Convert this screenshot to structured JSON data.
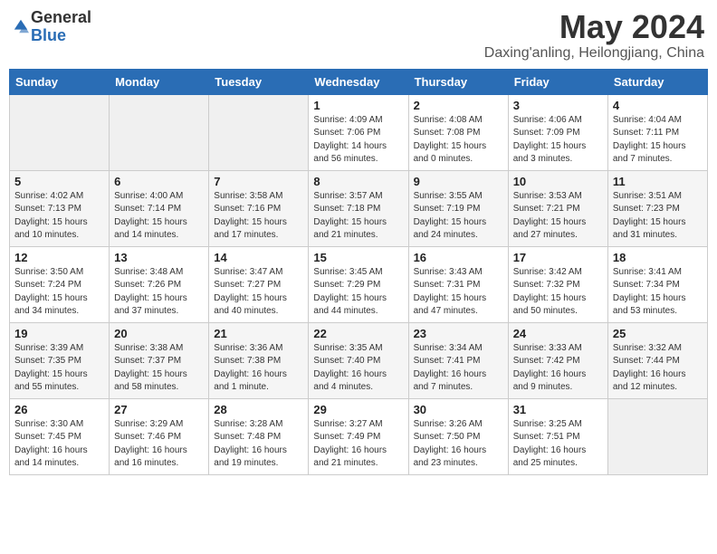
{
  "header": {
    "logo_general": "General",
    "logo_blue": "Blue",
    "month_title": "May 2024",
    "location": "Daxing'anling, Heilongjiang, China"
  },
  "weekdays": [
    "Sunday",
    "Monday",
    "Tuesday",
    "Wednesday",
    "Thursday",
    "Friday",
    "Saturday"
  ],
  "weeks": [
    [
      {
        "day": "",
        "info": ""
      },
      {
        "day": "",
        "info": ""
      },
      {
        "day": "",
        "info": ""
      },
      {
        "day": "1",
        "info": "Sunrise: 4:09 AM\nSunset: 7:06 PM\nDaylight: 14 hours\nand 56 minutes."
      },
      {
        "day": "2",
        "info": "Sunrise: 4:08 AM\nSunset: 7:08 PM\nDaylight: 15 hours\nand 0 minutes."
      },
      {
        "day": "3",
        "info": "Sunrise: 4:06 AM\nSunset: 7:09 PM\nDaylight: 15 hours\nand 3 minutes."
      },
      {
        "day": "4",
        "info": "Sunrise: 4:04 AM\nSunset: 7:11 PM\nDaylight: 15 hours\nand 7 minutes."
      }
    ],
    [
      {
        "day": "5",
        "info": "Sunrise: 4:02 AM\nSunset: 7:13 PM\nDaylight: 15 hours\nand 10 minutes."
      },
      {
        "day": "6",
        "info": "Sunrise: 4:00 AM\nSunset: 7:14 PM\nDaylight: 15 hours\nand 14 minutes."
      },
      {
        "day": "7",
        "info": "Sunrise: 3:58 AM\nSunset: 7:16 PM\nDaylight: 15 hours\nand 17 minutes."
      },
      {
        "day": "8",
        "info": "Sunrise: 3:57 AM\nSunset: 7:18 PM\nDaylight: 15 hours\nand 21 minutes."
      },
      {
        "day": "9",
        "info": "Sunrise: 3:55 AM\nSunset: 7:19 PM\nDaylight: 15 hours\nand 24 minutes."
      },
      {
        "day": "10",
        "info": "Sunrise: 3:53 AM\nSunset: 7:21 PM\nDaylight: 15 hours\nand 27 minutes."
      },
      {
        "day": "11",
        "info": "Sunrise: 3:51 AM\nSunset: 7:23 PM\nDaylight: 15 hours\nand 31 minutes."
      }
    ],
    [
      {
        "day": "12",
        "info": "Sunrise: 3:50 AM\nSunset: 7:24 PM\nDaylight: 15 hours\nand 34 minutes."
      },
      {
        "day": "13",
        "info": "Sunrise: 3:48 AM\nSunset: 7:26 PM\nDaylight: 15 hours\nand 37 minutes."
      },
      {
        "day": "14",
        "info": "Sunrise: 3:47 AM\nSunset: 7:27 PM\nDaylight: 15 hours\nand 40 minutes."
      },
      {
        "day": "15",
        "info": "Sunrise: 3:45 AM\nSunset: 7:29 PM\nDaylight: 15 hours\nand 44 minutes."
      },
      {
        "day": "16",
        "info": "Sunrise: 3:43 AM\nSunset: 7:31 PM\nDaylight: 15 hours\nand 47 minutes."
      },
      {
        "day": "17",
        "info": "Sunrise: 3:42 AM\nSunset: 7:32 PM\nDaylight: 15 hours\nand 50 minutes."
      },
      {
        "day": "18",
        "info": "Sunrise: 3:41 AM\nSunset: 7:34 PM\nDaylight: 15 hours\nand 53 minutes."
      }
    ],
    [
      {
        "day": "19",
        "info": "Sunrise: 3:39 AM\nSunset: 7:35 PM\nDaylight: 15 hours\nand 55 minutes."
      },
      {
        "day": "20",
        "info": "Sunrise: 3:38 AM\nSunset: 7:37 PM\nDaylight: 15 hours\nand 58 minutes."
      },
      {
        "day": "21",
        "info": "Sunrise: 3:36 AM\nSunset: 7:38 PM\nDaylight: 16 hours\nand 1 minute."
      },
      {
        "day": "22",
        "info": "Sunrise: 3:35 AM\nSunset: 7:40 PM\nDaylight: 16 hours\nand 4 minutes."
      },
      {
        "day": "23",
        "info": "Sunrise: 3:34 AM\nSunset: 7:41 PM\nDaylight: 16 hours\nand 7 minutes."
      },
      {
        "day": "24",
        "info": "Sunrise: 3:33 AM\nSunset: 7:42 PM\nDaylight: 16 hours\nand 9 minutes."
      },
      {
        "day": "25",
        "info": "Sunrise: 3:32 AM\nSunset: 7:44 PM\nDaylight: 16 hours\nand 12 minutes."
      }
    ],
    [
      {
        "day": "26",
        "info": "Sunrise: 3:30 AM\nSunset: 7:45 PM\nDaylight: 16 hours\nand 14 minutes."
      },
      {
        "day": "27",
        "info": "Sunrise: 3:29 AM\nSunset: 7:46 PM\nDaylight: 16 hours\nand 16 minutes."
      },
      {
        "day": "28",
        "info": "Sunrise: 3:28 AM\nSunset: 7:48 PM\nDaylight: 16 hours\nand 19 minutes."
      },
      {
        "day": "29",
        "info": "Sunrise: 3:27 AM\nSunset: 7:49 PM\nDaylight: 16 hours\nand 21 minutes."
      },
      {
        "day": "30",
        "info": "Sunrise: 3:26 AM\nSunset: 7:50 PM\nDaylight: 16 hours\nand 23 minutes."
      },
      {
        "day": "31",
        "info": "Sunrise: 3:25 AM\nSunset: 7:51 PM\nDaylight: 16 hours\nand 25 minutes."
      },
      {
        "day": "",
        "info": ""
      }
    ]
  ]
}
